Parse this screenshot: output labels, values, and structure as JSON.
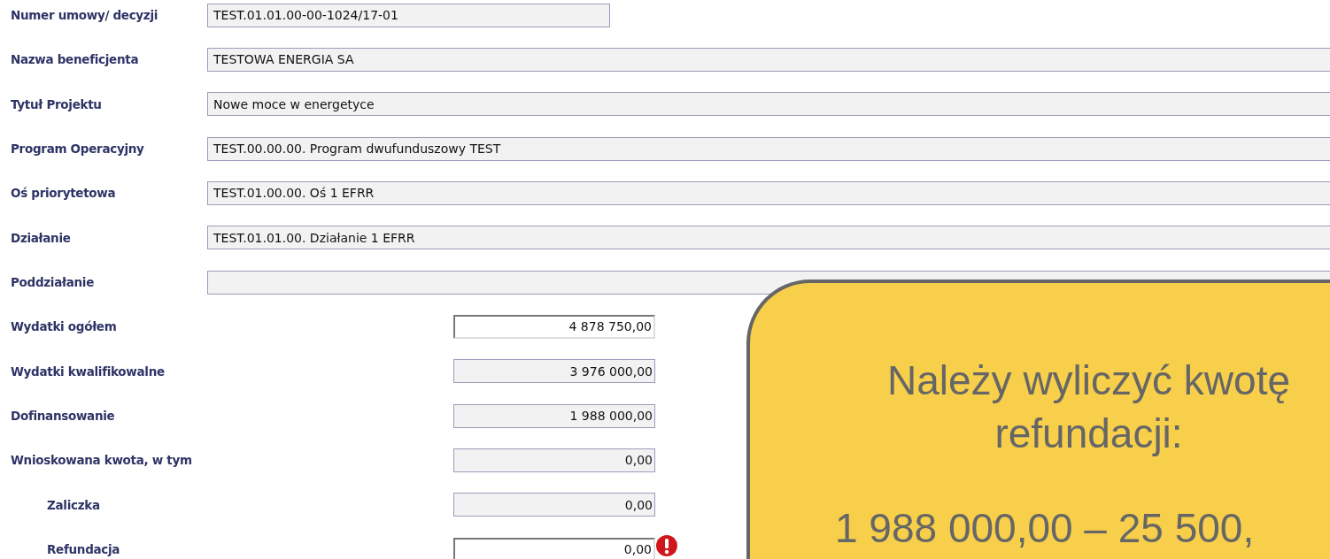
{
  "fields": [
    {
      "label": "Numer umowy/ decyzji",
      "kind": "short",
      "value": "TEST.01.01.00-00-1024/17-01",
      "editable": false
    },
    {
      "label": "Nazwa beneficjenta",
      "kind": "wide",
      "value": "TESTOWA ENERGIA SA",
      "editable": false
    },
    {
      "label": "Tytuł Projektu",
      "kind": "wide",
      "value": "Nowe moce w energetyce",
      "editable": false
    },
    {
      "label": "Program Operacyjny",
      "kind": "wide",
      "value": "TEST.00.00.00. Program dwufunduszowy TEST",
      "editable": false
    },
    {
      "label": "Oś priorytetowa",
      "kind": "wide",
      "value": "TEST.01.00.00. Oś 1 EFRR",
      "editable": false
    },
    {
      "label": "Działanie",
      "kind": "wide",
      "value": "TEST.01.01.00. Działanie 1 EFRR",
      "editable": false
    },
    {
      "label": "Poddziałanie",
      "kind": "wide",
      "editable": false
    },
    {
      "label": "Wydatki ogółem",
      "kind": "amount",
      "value": "4 878 750,00",
      "editable": true
    },
    {
      "label": "Wydatki kwalifikowalne",
      "kind": "amount",
      "value": "3 976 000,00",
      "editable": false
    },
    {
      "label": "Dofinansowanie",
      "kind": "amount",
      "value": "1 988 000,00",
      "editable": false
    },
    {
      "label": "Wnioskowana kwota, w tym",
      "kind": "amount",
      "value": "0,00",
      "editable": false,
      "children": [
        {
          "label": "Zaliczka",
          "kind": "amount",
          "value": "0,00",
          "editable": false
        },
        {
          "label": "Refundacja",
          "kind": "amount",
          "value": "0,00",
          "editable": true,
          "error": true
        }
      ]
    }
  ],
  "callout": {
    "heading": "Należy wyliczyć kwotę refundacji:",
    "formula": "1 988 000,00 – 25 500,"
  }
}
